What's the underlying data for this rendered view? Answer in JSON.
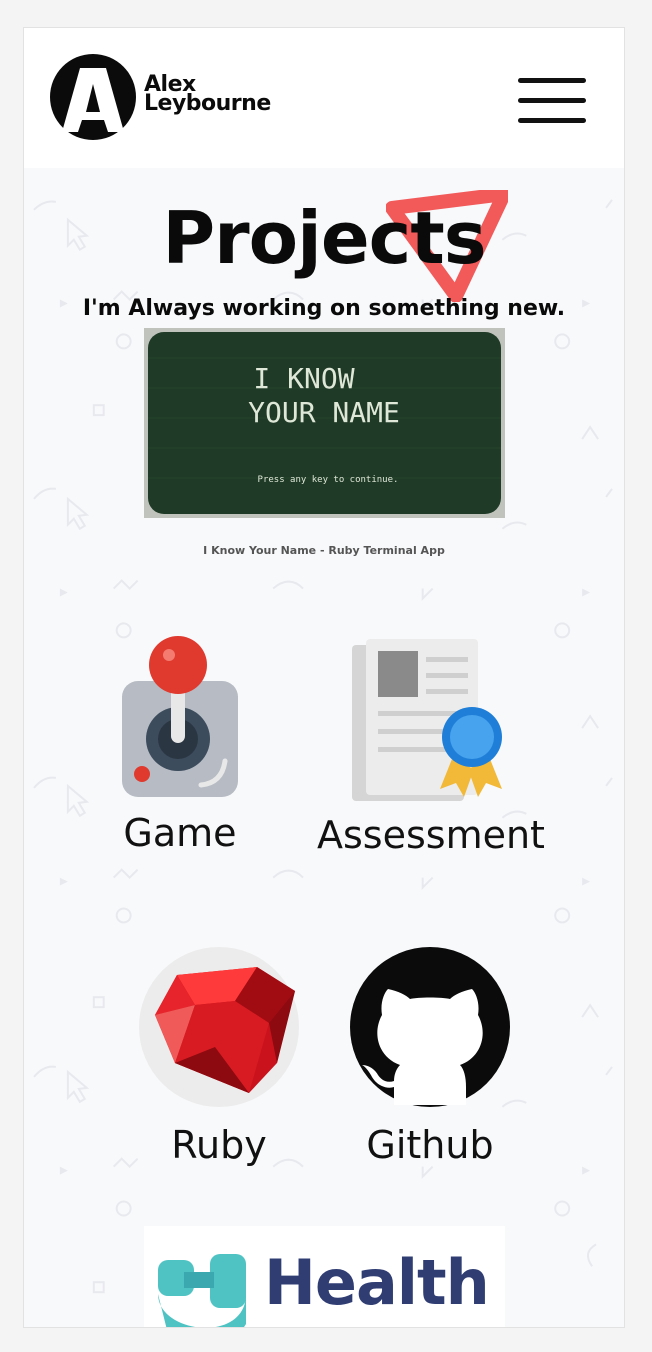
{
  "header": {
    "brand_line1": "Alex",
    "brand_line2": "Leybourne",
    "logo_icon": "a-monogram-logo",
    "menu_icon": "hamburger-menu-icon"
  },
  "main": {
    "title": "Projects",
    "subtitle": "I'm Always working on something new.",
    "featured": {
      "screen_line1": "I KNOW",
      "screen_line2": "YOUR NAME",
      "screen_hint": "Press any key to continue.",
      "caption": "I Know Your Name - Ruby Terminal App"
    },
    "tiles": [
      {
        "label": "Game",
        "icon": "joystick-icon"
      },
      {
        "label": "Assessment",
        "icon": "certificate-icon"
      },
      {
        "label": "Ruby",
        "icon": "ruby-gem-icon"
      },
      {
        "label": "Github",
        "icon": "github-octocat-icon"
      }
    ],
    "health_banner": {
      "text": "Health",
      "icon": "health-logo-icon"
    }
  },
  "colors": {
    "accent_triangle": "#f25a5a",
    "terminal_bg": "#1f3a27",
    "ruby_red": "#e01b24",
    "health_blue": "#2f3d73",
    "health_teal": "#4fc3c3"
  }
}
